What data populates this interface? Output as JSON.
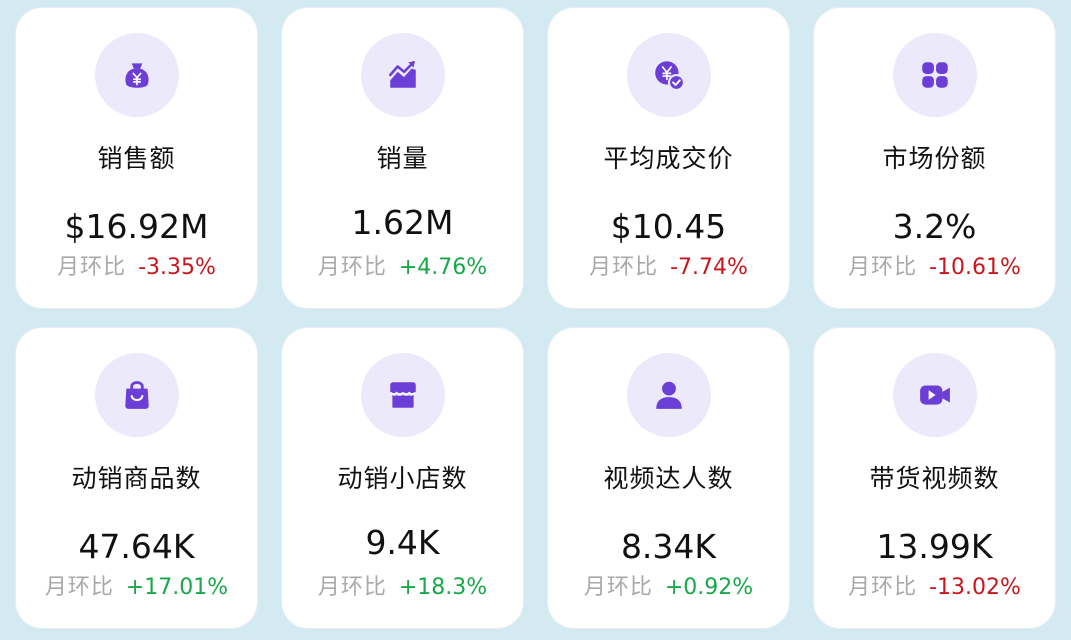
{
  "colors": {
    "background": "#d3eaf3",
    "icon_bg": "#ece9fb",
    "icon": "#6b3fd6",
    "negative": "#c8161d",
    "positive": "#17a84a",
    "muted": "#a9a9a9"
  },
  "cards": [
    {
      "icon": "money-bag-icon",
      "title": "销售额",
      "value": "$16.92M",
      "compare_label": "月环比",
      "change": "-3.35%"
    },
    {
      "icon": "trend-chart-icon",
      "title": "销量",
      "value": "1.62M",
      "compare_label": "月环比",
      "change": "+4.76%"
    },
    {
      "icon": "yen-check-icon",
      "title": "平均成交价",
      "value": "$10.45",
      "compare_label": "月环比",
      "change": "-7.74%"
    },
    {
      "icon": "grid-apps-icon",
      "title": "市场份额",
      "value": "3.2%",
      "compare_label": "月环比",
      "change": "-10.61%"
    },
    {
      "icon": "shopping-bag-icon",
      "title": "动销商品数",
      "value": "47.64K",
      "compare_label": "月环比",
      "change": "+17.01%"
    },
    {
      "icon": "storefront-icon",
      "title": "动销小店数",
      "value": "9.4K",
      "compare_label": "月环比",
      "change": "+18.3%"
    },
    {
      "icon": "person-icon",
      "title": "视频达人数",
      "value": "8.34K",
      "compare_label": "月环比",
      "change": "+0.92%"
    },
    {
      "icon": "video-camera-icon",
      "title": "带货视频数",
      "value": "13.99K",
      "compare_label": "月环比",
      "change": "-13.02%"
    }
  ]
}
